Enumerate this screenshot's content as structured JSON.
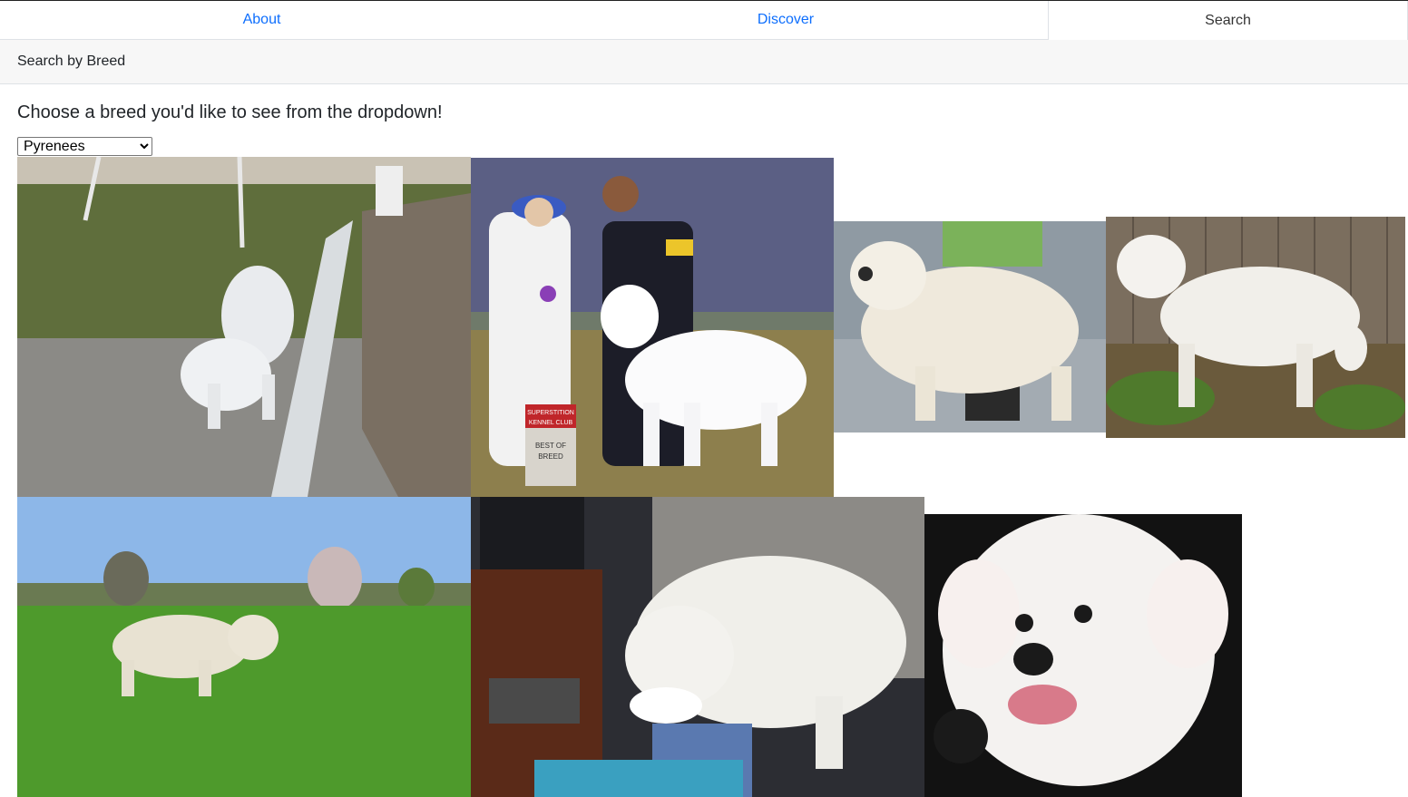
{
  "nav": {
    "tabs": [
      {
        "label": "About"
      },
      {
        "label": "Discover"
      },
      {
        "label": "Search"
      }
    ]
  },
  "card": {
    "header": "Search by Breed"
  },
  "main": {
    "prompt": "Choose a breed you'd like to see from the dropdown!",
    "breed_select": {
      "selected": "Pyrenees"
    }
  },
  "photos": [
    {
      "subject": "white dog by fence"
    },
    {
      "subject": "dog show award photo"
    },
    {
      "subject": "white dog standing with handler"
    },
    {
      "subject": "white dog by wooden fence"
    },
    {
      "subject": "white dog in green field"
    },
    {
      "subject": "white dog indoors"
    },
    {
      "subject": "white puppy close-up"
    }
  ],
  "show_sign": {
    "line1": "SUPERSTITION",
    "line2": "KENNEL CLUB",
    "line3": "BEST OF",
    "line4": "BREED"
  }
}
